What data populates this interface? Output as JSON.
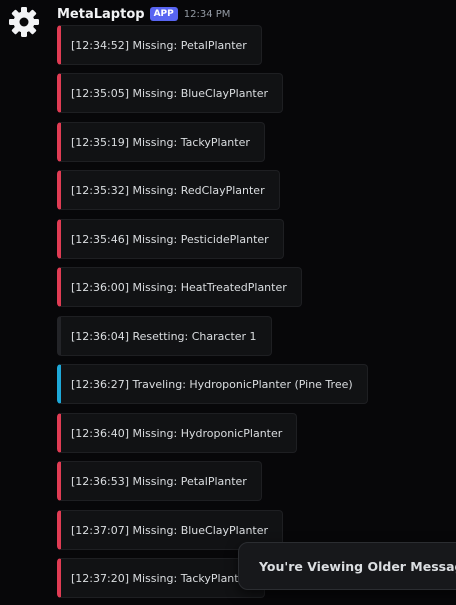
{
  "author": {
    "name": "MetaLaptop",
    "badge": "APP",
    "time": "12:34 PM",
    "avatar_icon": "gear-icon"
  },
  "messages": [
    {
      "text": "[12:34:52] Missing: PetalPlanter",
      "accent": "#e03c54"
    },
    {
      "text": "[12:35:05] Missing: BlueClayPlanter",
      "accent": "#e03c54"
    },
    {
      "text": "[12:35:19] Missing: TackyPlanter",
      "accent": "#e03c54"
    },
    {
      "text": "[12:35:32] Missing: RedClayPlanter",
      "accent": "#e03c54"
    },
    {
      "text": "[12:35:46] Missing: PesticidePlanter",
      "accent": "#e03c54"
    },
    {
      "text": "[12:36:00] Missing: HeatTreatedPlanter",
      "accent": "#e03c54"
    },
    {
      "text": "[12:36:04] Resetting: Character 1",
      "accent": "#232428"
    },
    {
      "text": "[12:36:27] Traveling: HydroponicPlanter (Pine Tree)",
      "accent": "#1ea8d8"
    },
    {
      "text": "[12:36:40] Missing: HydroponicPlanter",
      "accent": "#e03c54"
    },
    {
      "text": "[12:36:53] Missing: PetalPlanter",
      "accent": "#e03c54"
    },
    {
      "text": "[12:37:07] Missing: BlueClayPlanter",
      "accent": "#e03c54"
    },
    {
      "text": "[12:37:20] Missing: TackyPlanter",
      "accent": "#e03c54"
    }
  ],
  "toast": {
    "label": "You're Viewing Older Messages"
  }
}
